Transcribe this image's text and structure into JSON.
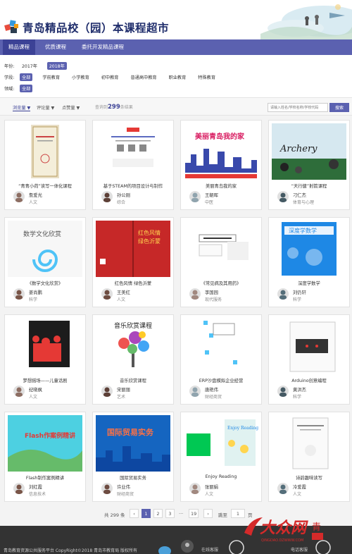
{
  "header": {
    "title": "青岛精品校（园）本课程超市"
  },
  "nav": {
    "tabs": [
      "精品课程",
      "优质课程",
      "委托开发精品课程"
    ],
    "active": 0
  },
  "filters": {
    "year": {
      "label": "年份:",
      "options": [
        "2017年",
        "2018年"
      ],
      "selected": 1
    },
    "level": {
      "label": "学段:",
      "options": [
        "全部",
        "学前教育",
        "小学教育",
        "初中教育",
        "普通高中教育",
        "职业教育",
        "特殊教育"
      ],
      "selected": 0
    },
    "domain": {
      "label": "领域:",
      "options": [
        "全部"
      ],
      "selected": 0
    }
  },
  "toolbar": {
    "sort": [
      "浏览量",
      "评论量",
      "点赞量"
    ],
    "total_prefix": "查询到",
    "total_count": "299",
    "total_suffix": "条结果",
    "search_placeholder": "请输入姓名/学校名称/学校代码",
    "search_button": "搜索"
  },
  "courses": [
    {
      "title": "“青青小荷”读写一体化课程",
      "teacher": "詹爱光",
      "field": "人文",
      "thumb": "certificate"
    },
    {
      "title": "基于STEAM的项目设计与制作",
      "teacher": "孙公刚",
      "field": "综合",
      "thumb": "steam"
    },
    {
      "title": "美丽青岛我的家",
      "teacher": "王朝晖",
      "field": "中医",
      "thumb": "city"
    },
    {
      "title": "“天行健”射箭课程",
      "teacher": "刁仁杰",
      "field": "体育与心理",
      "thumb": "archery"
    },
    {
      "title": "《数学文化欣赏》",
      "teacher": "姜尚鹏",
      "field": "科学",
      "thumb": "math"
    },
    {
      "title": "红色风情 绿色沂蒙",
      "teacher": "王美红",
      "field": "人文",
      "thumb": "red"
    },
    {
      "title": "《常见病及其用药》",
      "teacher": "李国园",
      "field": "现代服务",
      "thumb": "medicine"
    },
    {
      "title": "深度学数学",
      "teacher": "刘仍轩",
      "field": "科学",
      "thumb": "deepmath"
    },
    {
      "title": "梦想摇场——儿童话剧",
      "teacher": "纪晓枫",
      "field": "人文",
      "thumb": "drama"
    },
    {
      "title": "音乐欣赏课程",
      "teacher": "宋丽丽",
      "field": "艺术",
      "thumb": "music"
    },
    {
      "title": "ERP沙盘模拟企业经营",
      "teacher": "唐艳伟",
      "field": "财经商贸",
      "thumb": "erp"
    },
    {
      "title": "Arduino创意编程",
      "teacher": "黄洪杰",
      "field": "科学",
      "thumb": "arduino"
    },
    {
      "title": "Flash制作案例精讲",
      "teacher": "刘红霞",
      "field": "信息技术",
      "thumb": "flash"
    },
    {
      "title": "国际贸易实务",
      "teacher": "许业伟",
      "field": "财经商贸",
      "thumb": "trade"
    },
    {
      "title": "Enjoy Reading",
      "teacher": "张丽娟",
      "field": "人文",
      "thumb": "reading"
    },
    {
      "title": "诗韵趣味读写",
      "teacher": "冷爱霞",
      "field": "人文",
      "thumb": "poetry"
    }
  ],
  "pager": {
    "total": "共 299 条",
    "prev": "‹",
    "pages": [
      "1",
      "2",
      "3"
    ],
    "ellipsis": "···",
    "last": "19",
    "next": "›",
    "goto": "跳至",
    "page_input": "1",
    "page_unit": "页",
    "current": 0
  },
  "footer": {
    "copyright": "青岛教育资源公共服务平台 CopyRight©2018 青岛市教育局 版权所有",
    "online": "在线客服",
    "phone": "电话客服"
  },
  "colors": {
    "primary": "#5b61b0",
    "dark": "#3c4296",
    "footer": "#333333"
  }
}
